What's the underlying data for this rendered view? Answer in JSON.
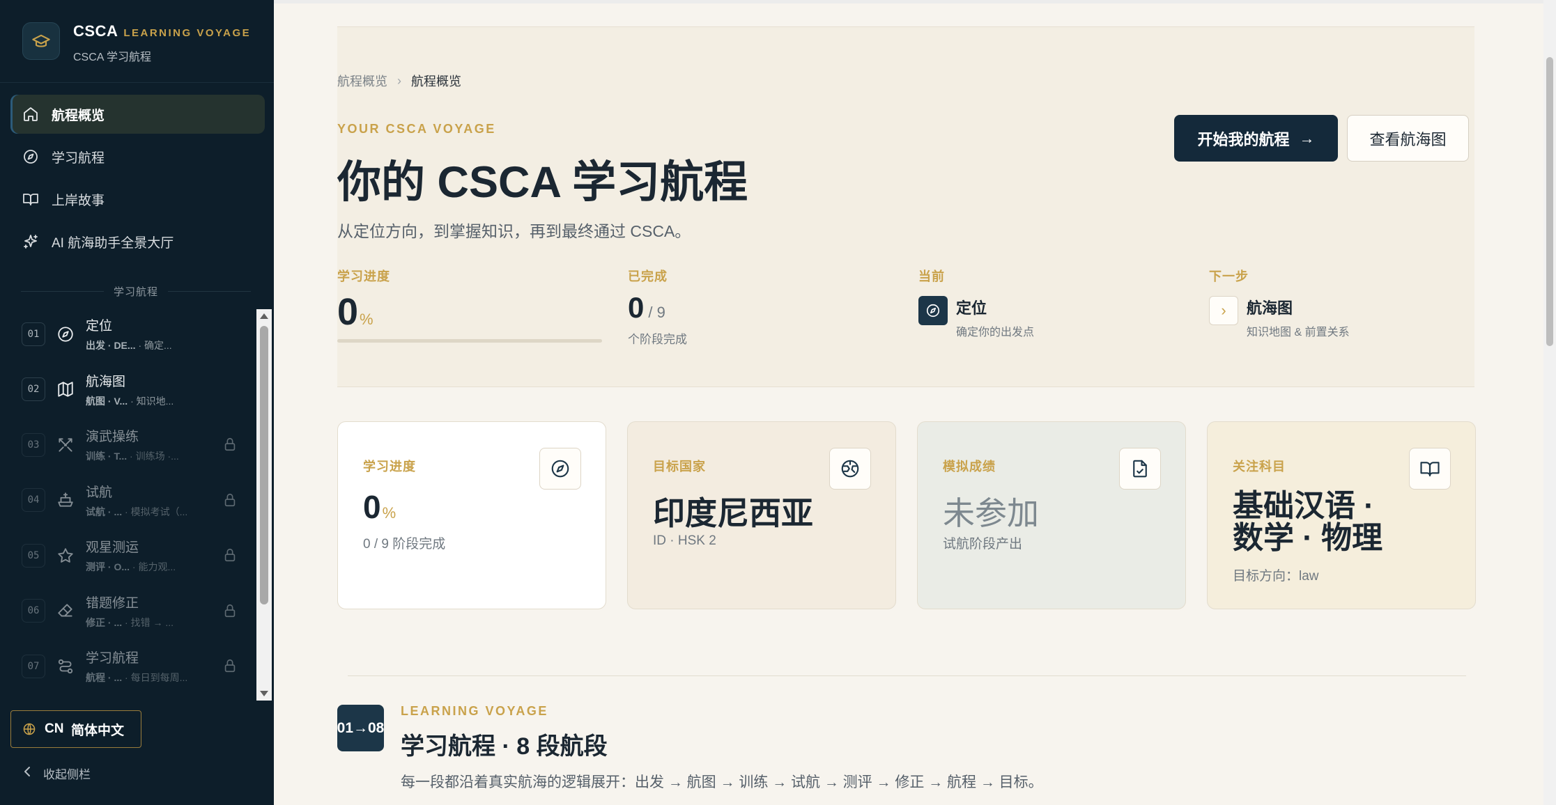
{
  "brand": {
    "name": "CSCA",
    "tag": "LEARNING VOYAGE",
    "subtitle": "CSCA 学习航程"
  },
  "nav": [
    {
      "label": "航程概览",
      "icon": "home-icon",
      "active": true
    },
    {
      "label": "学习航程",
      "icon": "compass-icon"
    },
    {
      "label": "上岸故事",
      "icon": "book-open-icon"
    },
    {
      "label": "AI 航海助手全景大厅",
      "icon": "sparkles-icon"
    }
  ],
  "stages_section_label": "学习航程",
  "stages": [
    {
      "num": "01",
      "title": "定位",
      "meta": "出发 · DE...",
      "desc": "· 确定...",
      "icon": "compass-icon",
      "locked": false
    },
    {
      "num": "02",
      "title": "航海图",
      "meta": "航图 · V...",
      "desc": "· 知识地...",
      "icon": "map-icon",
      "locked": false
    },
    {
      "num": "03",
      "title": "演武操练",
      "meta": "训练 · T...",
      "desc": "· 训练场 ·...",
      "icon": "swords-icon",
      "locked": true
    },
    {
      "num": "04",
      "title": "试航",
      "meta": "试航 · ...",
      "desc": "· 模拟考试（...",
      "icon": "ship-icon",
      "locked": true
    },
    {
      "num": "05",
      "title": "观星测运",
      "meta": "测评 · O...",
      "desc": "· 能力观...",
      "icon": "star-icon",
      "locked": true
    },
    {
      "num": "06",
      "title": "错题修正",
      "meta": "修正 · ...",
      "desc": "· 找错 → ...",
      "icon": "eraser-icon",
      "locked": true
    },
    {
      "num": "07",
      "title": "学习航程",
      "meta": "航程 · ...",
      "desc": "· 每日到每周...",
      "icon": "route-icon",
      "locked": true
    }
  ],
  "language": {
    "code": "CN",
    "label": "简体中文"
  },
  "collapse_label": "收起侧栏",
  "breadcrumb": [
    "航程概览",
    "航程概览"
  ],
  "hero": {
    "eyebrow": "YOUR CSCA VOYAGE",
    "title": "你的 CSCA 学习航程",
    "subtitle": "从定位方向，到掌握知识，再到最终通过 CSCA。",
    "primary_button": "开始我的航程",
    "primary_arrow": "→",
    "secondary_button": "查看航海图"
  },
  "stats": {
    "progress": {
      "label": "学习进度",
      "value": "0",
      "unit": "%",
      "fraction": 0
    },
    "completed": {
      "label": "已完成",
      "value": "0",
      "total": "/ 9",
      "caption": "个阶段完成"
    },
    "current": {
      "label": "当前",
      "title": "定位",
      "caption": "确定你的出发点"
    },
    "next": {
      "label": "下一步",
      "title": "航海图",
      "caption": "知识地图 & 前置关系",
      "chevron": "›"
    }
  },
  "cards": [
    {
      "label": "学习进度",
      "value": "0",
      "unit": "%",
      "sub": "0 / 9 阶段完成",
      "icon": "compass-icon"
    },
    {
      "label": "目标国家",
      "value": "印度尼西亚",
      "sub": "ID · HSK 2",
      "icon": "globe-icon"
    },
    {
      "label": "模拟成绩",
      "value": "未参加",
      "sub": "试航阶段产出",
      "icon": "file-check-icon"
    },
    {
      "label": "关注科目",
      "value_line1": "基础汉语 ·",
      "value_line2": "数学 · 物理",
      "sub": "目标方向：law",
      "icon": "book-open-icon"
    }
  ],
  "voyage": {
    "badge": "01→08",
    "eyebrow": "LEARNING VOYAGE",
    "title": "学习航程 · 8 段航段",
    "subtitle": "每一段都沿着真实航海的逻辑展开：出发 → 航图 → 训练 → 试航 → 测评 → 修正 → 航程 → 目标。"
  },
  "colors": {
    "sidebar": "#0d1e2a",
    "accent_gold": "#c9a24b",
    "navy": "#14293a",
    "cream": "#f3eee3"
  }
}
